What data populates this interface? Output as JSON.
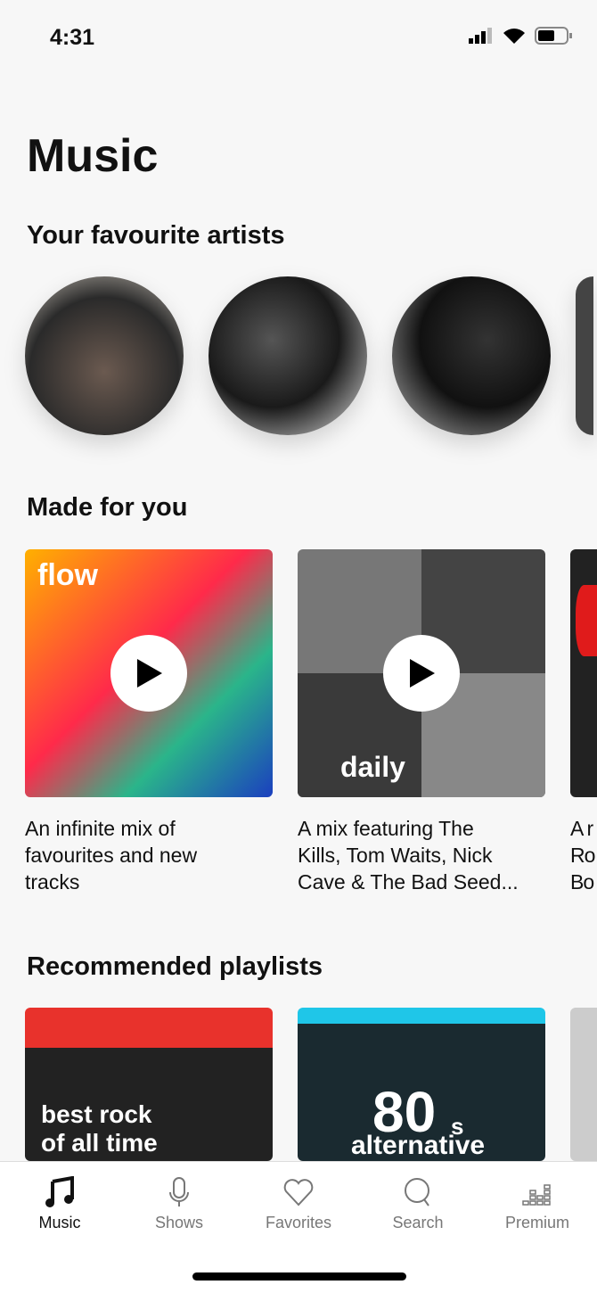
{
  "status": {
    "time": "4:31"
  },
  "title": "Music",
  "sections": {
    "artists": "Your favourite artists",
    "made": "Made for you",
    "recommended": "Recommended playlists"
  },
  "made_for_you": [
    {
      "label": "flow",
      "description": "An infinite mix of\nfavourites and new\ntracks"
    },
    {
      "label": "daily",
      "description": "A mix featuring The\nKills, Tom Waits, Nick\nCave & The Bad Seed..."
    },
    {
      "label": "",
      "description": "A r\nRo\nBo"
    }
  ],
  "playlists": [
    {
      "label": "best rock\nof all time"
    },
    {
      "label_big": "80",
      "label_suffix": "s",
      "label_sub": "alternative"
    }
  ],
  "tabs": [
    {
      "label": "Music",
      "icon": "music-note-icon",
      "active": true
    },
    {
      "label": "Shows",
      "icon": "microphone-icon"
    },
    {
      "label": "Favorites",
      "icon": "heart-icon"
    },
    {
      "label": "Search",
      "icon": "search-icon"
    },
    {
      "label": "Premium",
      "icon": "equalizer-icon"
    }
  ]
}
